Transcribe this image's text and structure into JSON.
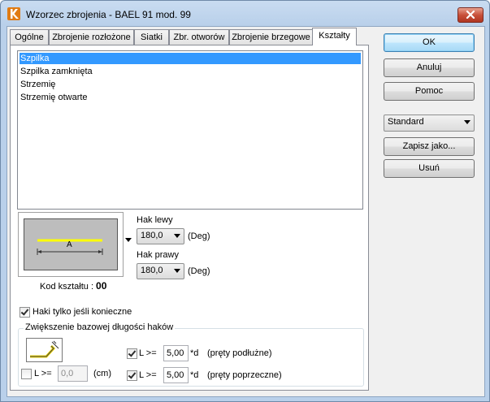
{
  "window": {
    "title": "Wzorzec zbrojenia - BAEL 91 mod. 99"
  },
  "tabs": [
    {
      "label": "Ogólne"
    },
    {
      "label": "Zbrojenie rozłożone"
    },
    {
      "label": "Siatki"
    },
    {
      "label": "Zbr. otworów"
    },
    {
      "label": "Zbrojenie brzegowe"
    },
    {
      "label": "Kształty"
    }
  ],
  "active_tab": "Kształty",
  "shapes_list": {
    "items": [
      "Szpilka",
      "Szpilka zamknięta",
      "Strzemię",
      "Strzemię otwarte"
    ],
    "selected": "Szpilka"
  },
  "shape_preview": {
    "dimension_label": "A"
  },
  "shape_code": {
    "label": "Kod kształtu :",
    "value": "00"
  },
  "hooks": {
    "left_label": "Hak lewy",
    "left_value": "180,0",
    "right_label": "Hak prawy",
    "right_value": "180,0",
    "unit": "(Deg)"
  },
  "hooks_only_if_needed": {
    "label": "Haki tylko jeśli konieczne",
    "checked": true
  },
  "base_length_group": {
    "title": "Zwiększenie bazowej długości haków",
    "length_check_label": "L >=",
    "length_checked": false,
    "length_value": "0,0",
    "length_unit": "(cm)",
    "longitudinal": {
      "label": "L >=",
      "checked": true,
      "value": "5,00",
      "suffix": "*d",
      "note": "(pręty podłużne)"
    },
    "transverse": {
      "label": "L >=",
      "checked": true,
      "value": "5,00",
      "suffix": "*d",
      "note": "(pręty poprzeczne)"
    }
  },
  "buttons": {
    "ok": "OK",
    "cancel": "Anuluj",
    "help": "Pomoc",
    "save_as": "Zapisz jako...",
    "delete": "Usuń"
  },
  "preset": {
    "selected": "Standard"
  },
  "colors": {
    "selection": "#3399ff",
    "rebar_line": "#ffff00",
    "default_button_border": "#3c7fb1"
  }
}
